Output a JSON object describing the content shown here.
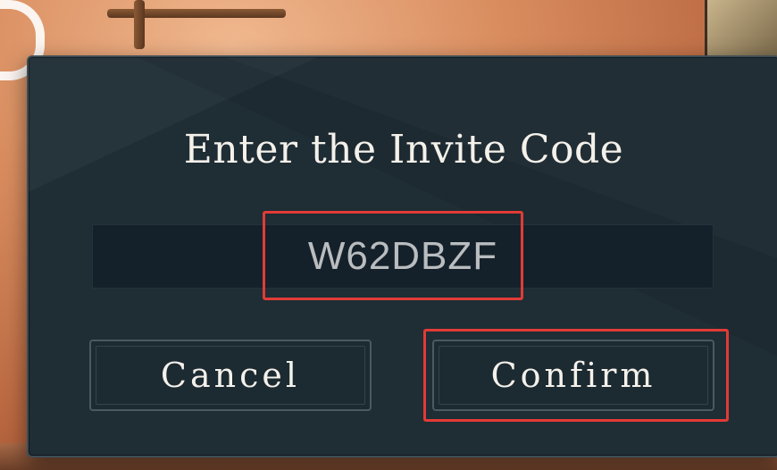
{
  "dialog": {
    "title": "Enter the Invite Code",
    "invite_code_value": "W62DBZF",
    "cancel_label": "Cancel",
    "confirm_label": "Confirm"
  },
  "colors": {
    "modal_background": "#1f2d35",
    "input_background": "#15212a",
    "text_primary": "#f4f1ea",
    "highlight": "#e23b36"
  }
}
